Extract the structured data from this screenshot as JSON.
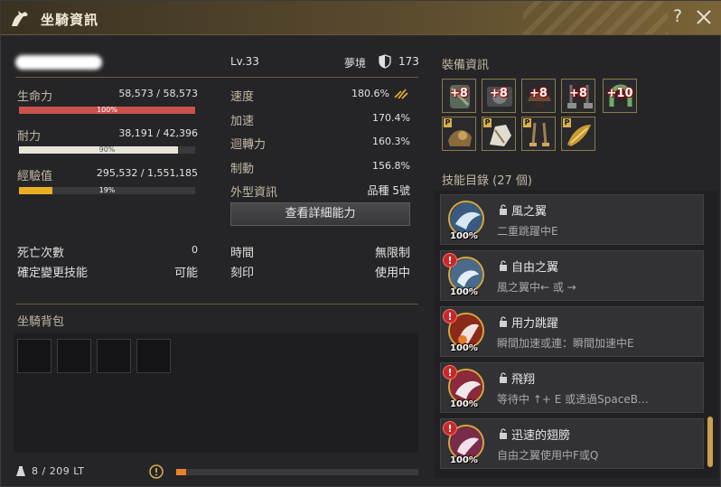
{
  "title": "坐騎資訊",
  "title_help": "?",
  "profile": {
    "level": "Lv.33",
    "dream_label": "夢境",
    "dream_value": "173"
  },
  "stats": {
    "hp": {
      "label": "生命力",
      "value": "58,573 / 58,573",
      "percent": "100%",
      "fraction": 1.0,
      "color": "#c9534a"
    },
    "stamina": {
      "label": "耐力",
      "value": "38,191 / 42,396",
      "percent": "90%",
      "fraction": 0.9,
      "color": "#e8e4d8"
    },
    "exp": {
      "label": "經驗值",
      "value": "295,532 / 1,551,185",
      "percent": "19%",
      "fraction": 0.19,
      "color": "#e8b020"
    },
    "speed": {
      "label": "速度",
      "value": "180.6%"
    },
    "accel": {
      "label": "加速",
      "value": "170.4%"
    },
    "turn": {
      "label": "迴轉力",
      "value": "160.3%"
    },
    "brake": {
      "label": "制動",
      "value": "156.8%"
    },
    "appearance": {
      "label": "外型資訊",
      "value": "品種 5號"
    },
    "deaths": {
      "label": "死亡次數",
      "value": "0"
    },
    "skill_change": {
      "label": "確定變更技能",
      "value": "可能"
    },
    "time": {
      "label": "時間",
      "value": "無限制"
    },
    "imprint": {
      "label": "刻印",
      "value": "使用中"
    }
  },
  "detail_button": "查看詳細能力",
  "bag": {
    "title": "坐騎背包",
    "weight": "8 / 209 LT",
    "weight_fraction": 0.04
  },
  "equipment": {
    "title": "裝備資訊",
    "row1": [
      {
        "enh": "+8",
        "icon": "gauntlet-icon"
      },
      {
        "enh": "+8",
        "icon": "barding-icon"
      },
      {
        "enh": "+8",
        "icon": "saddle-icon"
      },
      {
        "enh": "+8",
        "icon": "stirrups-icon"
      },
      {
        "enh": "+10",
        "icon": "horseshoe-icon"
      }
    ],
    "row2": [
      {
        "badge": "P",
        "icon": "pet-armor-icon"
      },
      {
        "badge": "P",
        "icon": "pet-head-icon"
      },
      {
        "badge": "P",
        "icon": "pet-stirrup-icon"
      },
      {
        "badge": "P",
        "icon": "pet-wing-icon"
      }
    ]
  },
  "skills": {
    "title": "技能目錄 (27 個)",
    "items": [
      {
        "name": "風之翼",
        "desc": "二重跳躍中E",
        "pct": "100%",
        "alert": false,
        "color": "#9ab8d8"
      },
      {
        "name": "自由之翼",
        "desc": "風之翼中← 或 →",
        "pct": "100%",
        "alert": true,
        "alert_text": "!",
        "color": "#a8c4e0"
      },
      {
        "name": "用力跳躍",
        "desc": "瞬間加速或連：瞬間加速中E",
        "pct": "100%",
        "alert": true,
        "alert_text": "!",
        "color": "#d86a4a"
      },
      {
        "name": "飛翔",
        "desc": "等待中 ↑+ E 或透過SpaceB…",
        "pct": "100%",
        "alert": true,
        "alert_text": "!",
        "color": "#d06a6a"
      },
      {
        "name": "迅速的翅膀",
        "desc": "自由之翼使用中F或Q",
        "pct": "100%",
        "alert": true,
        "alert_text": "!",
        "color": "#c85a7a"
      }
    ]
  }
}
